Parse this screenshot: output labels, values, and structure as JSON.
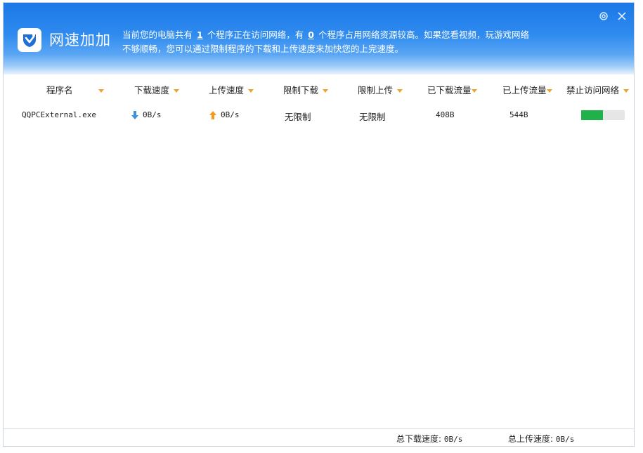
{
  "header": {
    "app_title": "网速加加",
    "msg_prefix": "当前您的电脑共有",
    "program_count": "1",
    "msg_mid": "个程序正在访问网络，有",
    "heavy_count": "0",
    "msg_suffix": "个程序占用网络资源较高。如果您看视频，玩游戏网络",
    "msg_line2": "不够顺畅，您可以通过限制程序的下载和上传速度来加快您的上完速度。",
    "icons": {
      "settings": "gear-icon",
      "close": "close-icon",
      "logo": "rocket-shield-icon"
    }
  },
  "columns": [
    {
      "label": "程序名"
    },
    {
      "label": "下载速度"
    },
    {
      "label": "上传速度"
    },
    {
      "label": "限制下载"
    },
    {
      "label": "限制上传"
    },
    {
      "label": "已下载流量"
    },
    {
      "label": "已上传流量"
    },
    {
      "label": "禁止访问网络"
    }
  ],
  "rows": [
    {
      "name": "QQPCExternal.exe",
      "download_speed": "0B/s",
      "upload_speed": "0B/s",
      "limit_download": "无限制",
      "limit_upload": "无限制",
      "downloaded": "408B",
      "uploaded": "544B",
      "block_level": 0.5
    }
  ],
  "footer": {
    "total_download_label": "总下载速度:",
    "total_download_value": "0B/s",
    "total_upload_label": "总上传速度:",
    "total_upload_value": "0B/s"
  },
  "colors": {
    "header_blue": "#1b78e6",
    "accent_arrow": "#f0a22a",
    "download_icon": "#3d8fe0",
    "upload_icon": "#f39a1e",
    "toggle_on": "#21b14b"
  }
}
